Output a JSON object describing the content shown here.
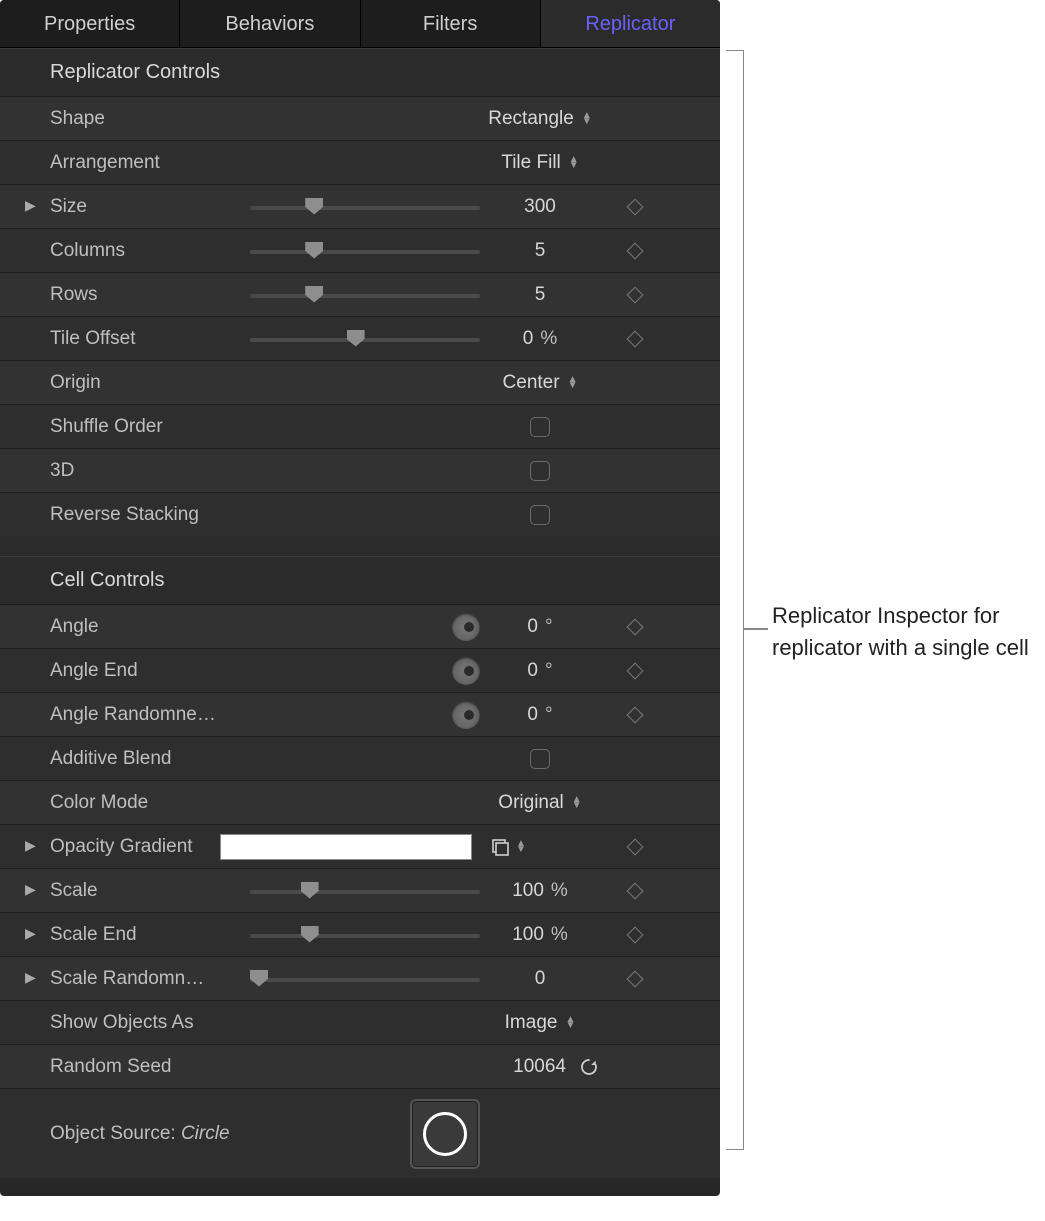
{
  "tabs": [
    "Properties",
    "Behaviors",
    "Filters",
    "Replicator"
  ],
  "active_tab": "Replicator",
  "sections": {
    "replicator": {
      "title": "Replicator Controls",
      "shape": {
        "label": "Shape",
        "value": "Rectangle"
      },
      "arrangement": {
        "label": "Arrangement",
        "value": "Tile Fill"
      },
      "size": {
        "label": "Size",
        "value": "300",
        "slider_pct": 24,
        "disclosure": true
      },
      "columns": {
        "label": "Columns",
        "value": "5",
        "slider_pct": 24
      },
      "rows": {
        "label": "Rows",
        "value": "5",
        "slider_pct": 24
      },
      "tile_offset": {
        "label": "Tile Offset",
        "value": "0",
        "unit": "%",
        "slider_pct": 42
      },
      "origin": {
        "label": "Origin",
        "value": "Center"
      },
      "shuffle": {
        "label": "Shuffle Order",
        "checked": false
      },
      "three_d": {
        "label": "3D",
        "checked": false
      },
      "reverse_stacking": {
        "label": "Reverse Stacking",
        "checked": false
      }
    },
    "cell": {
      "title": "Cell Controls",
      "angle": {
        "label": "Angle",
        "value": "0",
        "unit": "°"
      },
      "angle_end": {
        "label": "Angle End",
        "value": "0",
        "unit": "°"
      },
      "angle_rand": {
        "label": "Angle Randomne…",
        "value": "0",
        "unit": "°"
      },
      "additive_blend": {
        "label": "Additive Blend",
        "checked": false
      },
      "color_mode": {
        "label": "Color Mode",
        "value": "Original"
      },
      "opacity_gradient": {
        "label": "Opacity Gradient",
        "disclosure": true
      },
      "scale": {
        "label": "Scale",
        "value": "100",
        "unit": "%",
        "slider_pct": 22,
        "disclosure": true
      },
      "scale_end": {
        "label": "Scale End",
        "value": "100",
        "unit": "%",
        "slider_pct": 22,
        "disclosure": true
      },
      "scale_rand": {
        "label": "Scale Randomn…",
        "value": "0",
        "slider_pct": 0,
        "disclosure": true
      },
      "show_objects_as": {
        "label": "Show Objects As",
        "value": "Image"
      },
      "random_seed": {
        "label": "Random Seed",
        "value": "10064"
      },
      "object_source": {
        "label_prefix": "Object Source:",
        "name": "Circle"
      }
    }
  },
  "annotation": "Replicator Inspector for replicator with a single cell"
}
